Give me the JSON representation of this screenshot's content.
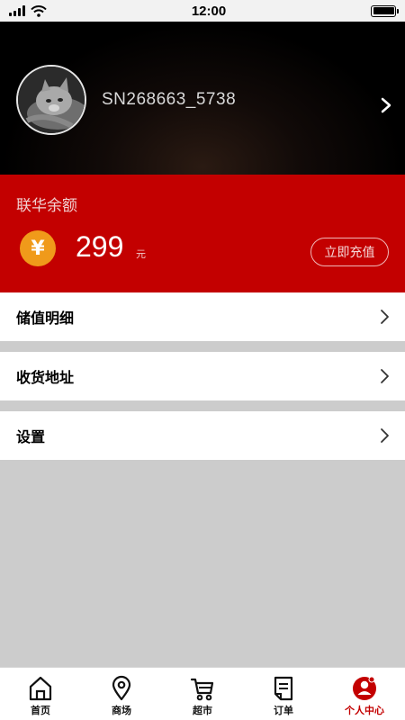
{
  "status_bar": {
    "time": "12:00"
  },
  "profile": {
    "username": "SN268663_5738"
  },
  "balance": {
    "title": "联华余额",
    "currency_symbol": "¥",
    "amount": "299",
    "unit": "元",
    "recharge_label": "立即充值"
  },
  "menu": {
    "items": [
      {
        "label": "储值明细"
      },
      {
        "label": "收货地址"
      },
      {
        "label": "设置"
      }
    ]
  },
  "tab_bar": {
    "tabs": [
      {
        "label": "首页",
        "icon": "home-icon"
      },
      {
        "label": "商场",
        "icon": "location-pin-icon"
      },
      {
        "label": "超市",
        "icon": "cart-icon"
      },
      {
        "label": "订单",
        "icon": "order-icon"
      },
      {
        "label": "个人中心",
        "icon": "profile-icon"
      }
    ],
    "active_index": 4
  },
  "colors": {
    "accent": "#c30000",
    "coin": "#f09a1a"
  }
}
